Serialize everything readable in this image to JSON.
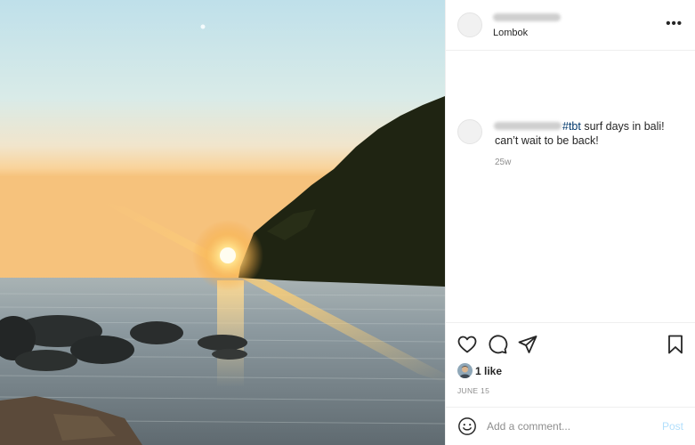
{
  "photo": {
    "alt": "sunset"
  },
  "header": {
    "location": "Lombok",
    "more_icon": "more-horizontal-icon",
    "more_label": "•••"
  },
  "caption": {
    "hashtag": "#tbt",
    "text": " surf days in bali! can’t wait to be back!",
    "timestamp": "25w"
  },
  "actions": {
    "icons": [
      "heart-icon",
      "comment-icon",
      "share-icon",
      "bookmark-icon"
    ]
  },
  "likes": {
    "label": "1 like"
  },
  "date": {
    "label": "JUNE 15"
  },
  "comment_bar": {
    "emoji_icon": "emoji-icon",
    "placeholder": "Add a comment...",
    "post_label": "Post"
  },
  "colors": {
    "hashtag": "#00376b",
    "post_disabled": "#b2dffc",
    "muted": "#8e8e8e",
    "border": "#efefef"
  }
}
